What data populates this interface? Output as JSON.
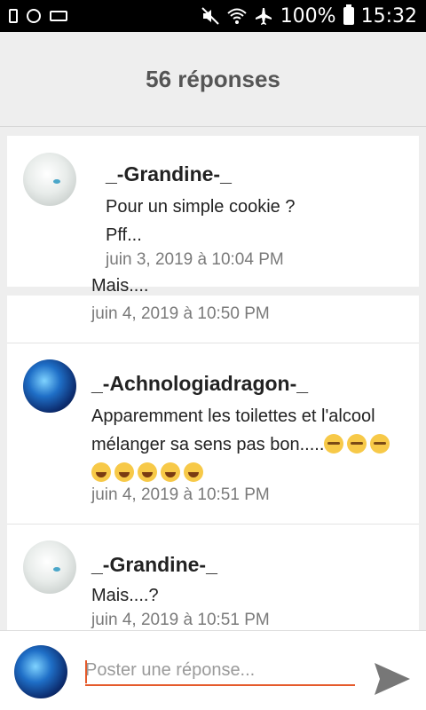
{
  "status_bar": {
    "battery_text": "100%",
    "time": "15:32",
    "icons": [
      "battery-level-icon",
      "messenger-icon",
      "voicemail-icon",
      "mute-icon",
      "wifi-icon",
      "airplane-mode-icon",
      "battery-icon"
    ]
  },
  "header": {
    "title": "56 réponses"
  },
  "op": {
    "username": "_-Grandine-_",
    "line1": "Pour un simple cookie ?",
    "line2": "Pff...",
    "time": "juin 3, 2019 à 10:04 PM"
  },
  "replies": [
    {
      "partial_text": "Mais....",
      "time": "juin 4, 2019 à 10:50 PM"
    },
    {
      "username": "_-Achnologiadragon-_",
      "line1": "Apparemment les toilettes et l'alcool",
      "line2": "mélanger sa sens pas bon.....",
      "emoji_tear": [
        "😢",
        "😢",
        "😢"
      ],
      "emoji_laugh": [
        "🤣",
        "🤣",
        "🤣",
        "🤣",
        "🤣"
      ],
      "time": "juin 4, 2019 à 10:51 PM"
    },
    {
      "username": "_-Grandine-_",
      "text": "Mais....?",
      "time": "juin 4, 2019 à 10:51 PM"
    }
  ],
  "footer": {
    "placeholder": "Poster une réponse...",
    "accent_color": "#e55a2b"
  }
}
